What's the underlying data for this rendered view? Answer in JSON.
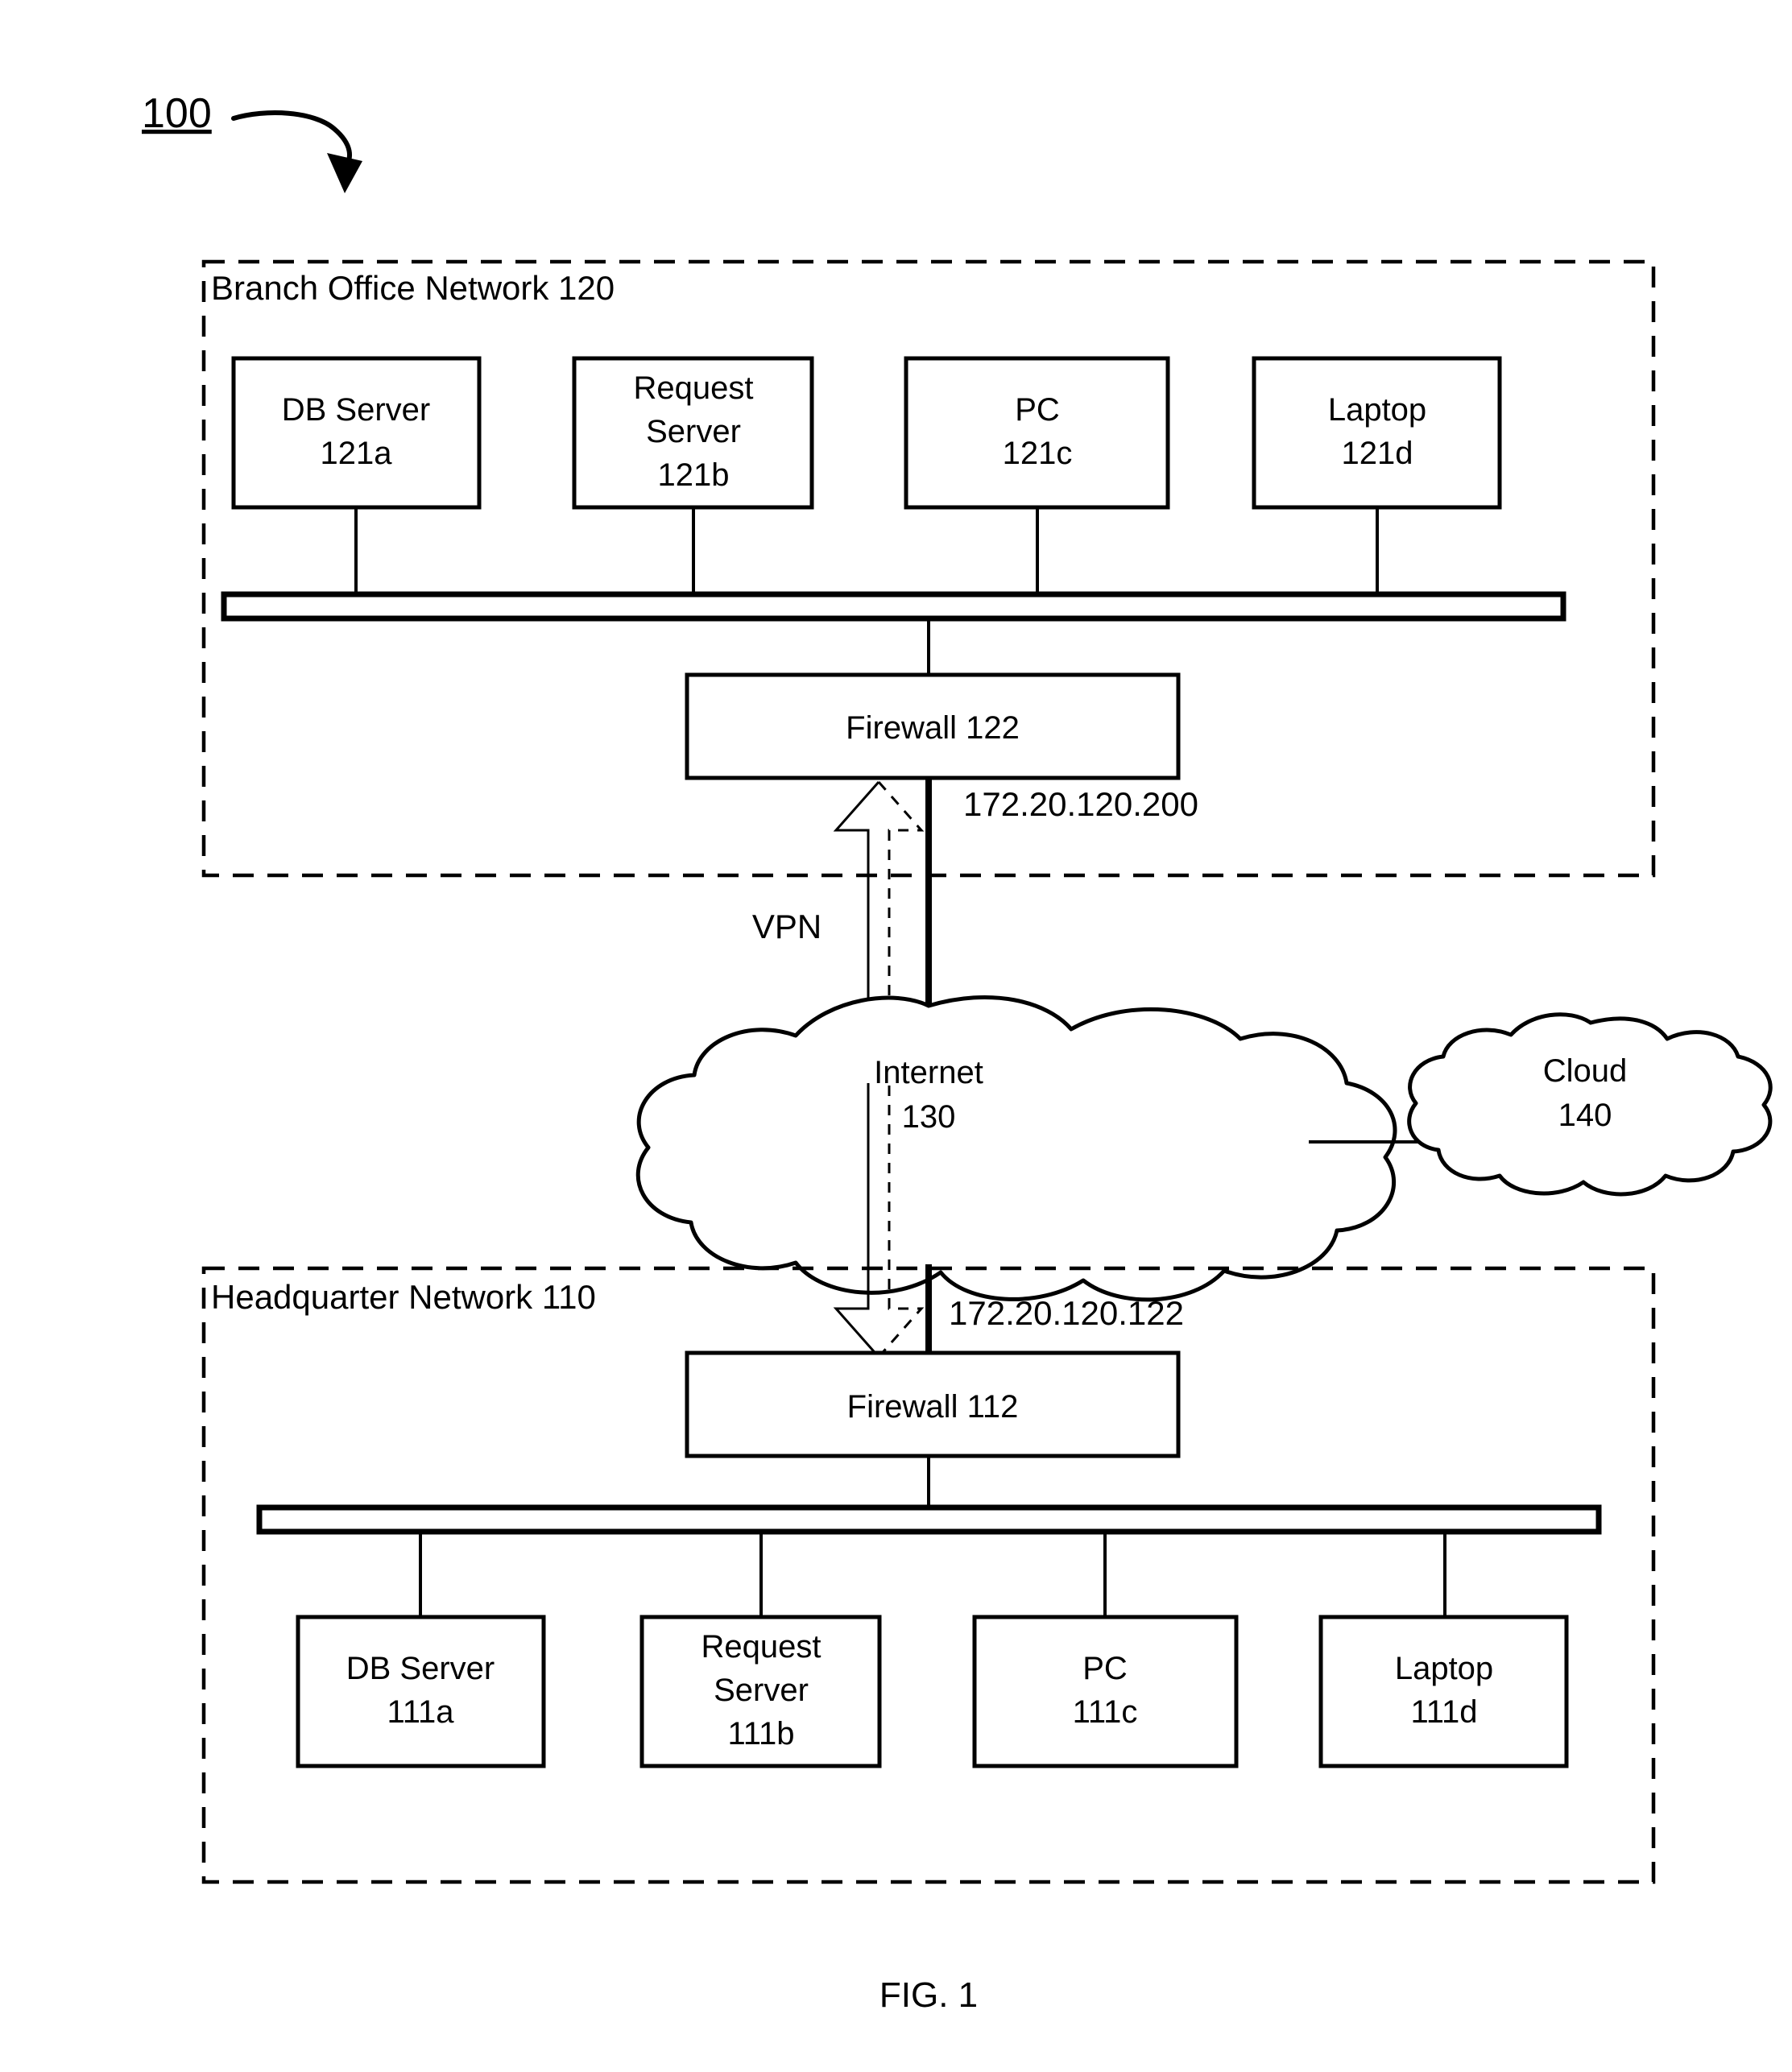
{
  "figure": {
    "reference_numeral": "100",
    "caption": "FIG. 1"
  },
  "networks": [
    {
      "id": "branch",
      "label": "Branch Office Network 120",
      "firewall": {
        "label": "Firewall 122",
        "ip": "172.20.120.200"
      },
      "devices": [
        {
          "name": "DB Server",
          "ref": "121a",
          "lines": [
            "DB Server",
            "121a"
          ]
        },
        {
          "name": "Request Server",
          "ref": "121b",
          "lines": [
            "Request",
            "Server",
            "121b"
          ]
        },
        {
          "name": "PC",
          "ref": "121c",
          "lines": [
            "PC",
            "121c"
          ]
        },
        {
          "name": "Laptop",
          "ref": "121d",
          "lines": [
            "Laptop",
            "121d"
          ]
        }
      ]
    },
    {
      "id": "headquarter",
      "label": "Headquarter Network 110",
      "firewall": {
        "label": "Firewall 112",
        "ip": "172.20.120.122"
      },
      "devices": [
        {
          "name": "DB Server",
          "ref": "111a",
          "lines": [
            "DB Server",
            "111a"
          ]
        },
        {
          "name": "Request Server",
          "ref": "111b",
          "lines": [
            "Request",
            "Server",
            "111b"
          ]
        },
        {
          "name": "PC",
          "ref": "111c",
          "lines": [
            "PC",
            "111c"
          ]
        },
        {
          "name": "Laptop",
          "ref": "111d",
          "lines": [
            "Laptop",
            "111d"
          ]
        }
      ]
    }
  ],
  "clouds": [
    {
      "id": "internet",
      "lines": [
        "Internet",
        "130"
      ],
      "name": "Internet",
      "ref": "130"
    },
    {
      "id": "external",
      "lines": [
        "Cloud",
        "140"
      ],
      "name": "Cloud",
      "ref": "140"
    }
  ],
  "connections": {
    "vpn_label": "VPN"
  },
  "colors": {
    "stroke": "#000000",
    "fill": "#ffffff"
  }
}
